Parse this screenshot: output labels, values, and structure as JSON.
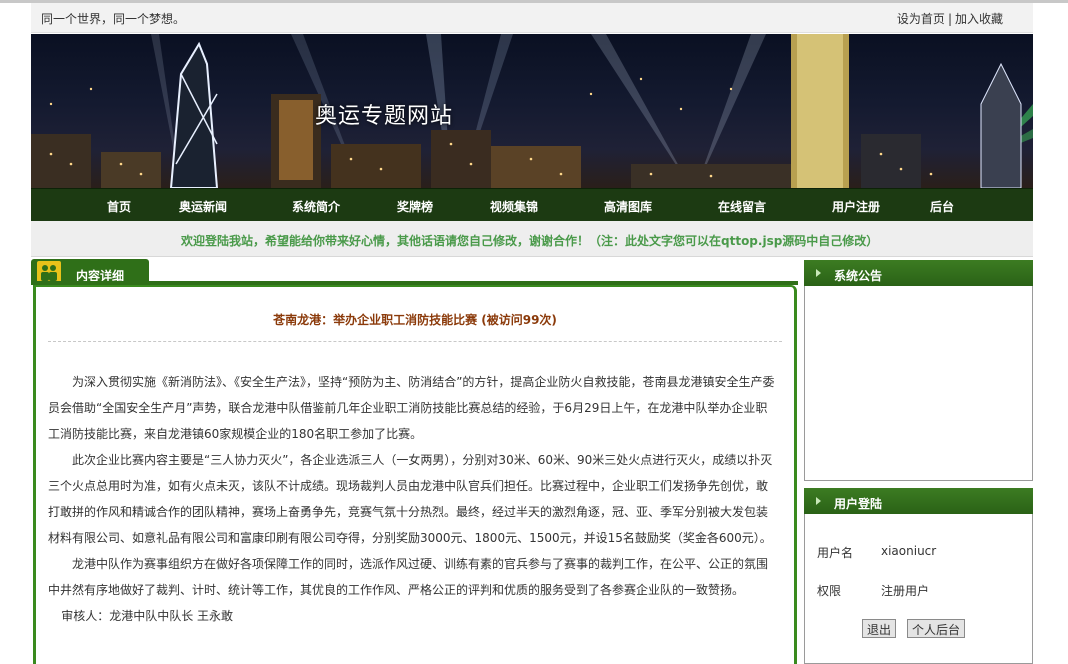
{
  "topbar": {
    "slogan": "同一个世界，同一个梦想。",
    "set_home": "设为首页",
    "separator": "|",
    "add_favorite": "加入收藏"
  },
  "banner": {
    "site_title": "奥运专题网站"
  },
  "nav": {
    "items": [
      "首页",
      "奥运新闻",
      "系统简介",
      "奖牌榜",
      "视频集锦",
      "高清图库",
      "在线留言",
      "用户注册",
      "后台"
    ]
  },
  "notice": {
    "text": "欢迎登陆我站，希望能给你带来好心情，其他话语请您自己修改，谢谢合作！（注：此处文字您可以在qttop.jsp源码中自己修改）"
  },
  "content": {
    "tab_label": "内容详细",
    "article_title": "苍南龙港：举办企业职工消防技能比赛 (被访问99次)",
    "paragraphs": [
      "为深入贯彻实施《新消防法》、《安全生产法》，坚持“预防为主、防消结合”的方针，提高企业防火自救技能，苍南县龙港镇安全生产委员会借助“全国安全生产月”声势，联合龙港中队借鉴前几年企业职工消防技能比赛总结的经验，于6月29日上午，在龙港中队举办企业职工消防技能比赛，来自龙港镇60家规模企业的180名职工参加了比赛。",
      "此次企业比赛内容主要是“三人协力灭火”，各企业选派三人（一女两男），分别对30米、60米、90米三处火点进行灭火，成绩以扑灭三个火点总用时为准，如有火点未灭，该队不计成绩。现场裁判人员由龙港中队官兵们担任。比赛过程中，企业职工们发扬争先创优，敢打敢拼的作风和精诚合作的团队精神，赛场上奋勇争先，竞赛气氛十分热烈。最终，经过半天的激烈角逐，冠、亚、季军分别被大发包装材料有限公司、如意礼品有限公司和富康印刷有限公司夺得，分别奖励3000元、1800元、1500元，并设15名鼓励奖（奖金各600元）。",
      "龙港中队作为赛事组织方在做好各项保障工作的同时，选派作风过硬、训练有素的官兵参与了赛事的裁判工作，在公平、公正的氛围中井然有序地做好了裁判、计时、统计等工作，其优良的工作作风、严格公正的评判和优质的服务受到了各参赛企业队的一致赞扬。"
    ],
    "reviewer": "审核人：龙港中队中队长 王永敢"
  },
  "sidebar": {
    "announcement_title": "系统公告",
    "login_title": "用户登陆",
    "username_label": "用户名",
    "username_value": "xiaoniucr",
    "role_label": "权限",
    "role_value": "注册用户",
    "logout_button": "退出",
    "backend_button": "个人后台"
  },
  "colors": {
    "nav_bg": "#1c3a12",
    "accent_green": "#3a8a1e",
    "notice_text": "#4a9a4a",
    "title_brown": "#8b3a0a"
  }
}
